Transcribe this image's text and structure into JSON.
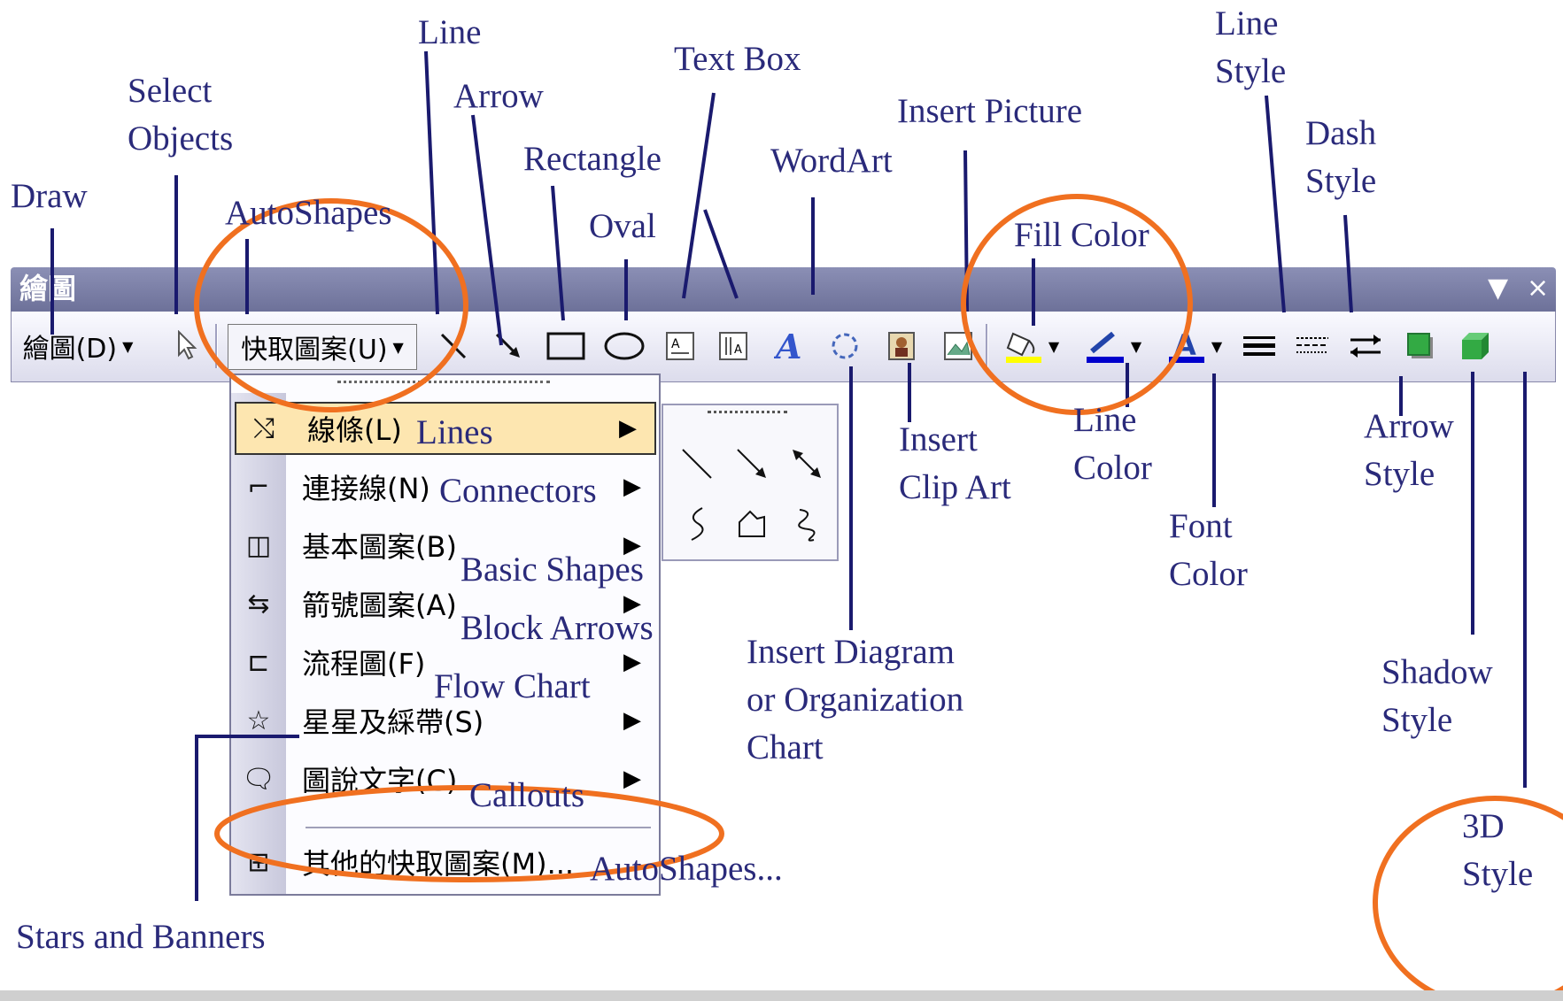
{
  "toolbar": {
    "window_title": "繪圖",
    "draw_label": "繪圖(D)",
    "autoshapes_label": "快取圖案(U)",
    "menu_arrow_glyph": "▾",
    "close_glyph": "×"
  },
  "autoshapes_menu": [
    {
      "label": "線條(L)",
      "en": "Lines",
      "icon": "lines-icon",
      "glyph": "⤭"
    },
    {
      "label": "連接線(N)",
      "en": "Connectors",
      "icon": "connectors-icon",
      "glyph": "⌐"
    },
    {
      "label": "基本圖案(B)",
      "en": "Basic Shapes",
      "icon": "basic-shapes-icon",
      "glyph": "◫"
    },
    {
      "label": "箭號圖案(A)",
      "en": "Block Arrows",
      "icon": "block-arrows-icon",
      "glyph": "⇆"
    },
    {
      "label": "流程圖(F)",
      "en": "Flow Chart",
      "icon": "flow-chart-icon",
      "glyph": "⊏"
    },
    {
      "label": "星星及綵帶(S)",
      "en": "",
      "icon": "stars-banners-icon",
      "glyph": "☆"
    },
    {
      "label": "圖說文字(C)",
      "en": "Callouts",
      "icon": "callouts-icon",
      "glyph": "🗨"
    },
    {
      "label": "其他的快取圖案(M)...",
      "en": "AutoShapes...",
      "icon": "more-autoshapes-icon",
      "glyph": "⊞"
    }
  ],
  "annotations": {
    "draw": "Draw",
    "select_objects": "Select\nObjects",
    "autoshapes": "AutoShapes",
    "line": "Line",
    "arrow": "Arrow",
    "rectangle": "Rectangle",
    "oval": "Oval",
    "text_box": "Text Box",
    "wordart": "WordArt",
    "insert_picture": "Insert Picture",
    "fill_color": "Fill Color",
    "line_style": "Line\nStyle",
    "dash_style": "Dash\nStyle",
    "insert_clip_art": "Insert\nClip Art",
    "line_color": "Line\nColor",
    "font_color": "Font\nColor",
    "arrow_style": "Arrow\nStyle",
    "insert_diagram": "Insert Diagram\nor Organization\nChart",
    "shadow_style": "Shadow\nStyle",
    "three_d_style": "3D\nStyle",
    "stars_and_banners": "Stars and Banners"
  },
  "colors": {
    "annotation_text": "#2a2a7a",
    "pointer_line": "#1a1a6e",
    "highlight_circle": "#f07020",
    "fill_color_swatch": "#ffff00",
    "line_color_swatch": "#0000cc",
    "font_color_swatch": "#0000cc",
    "menu_highlight": "#fde6b0"
  }
}
